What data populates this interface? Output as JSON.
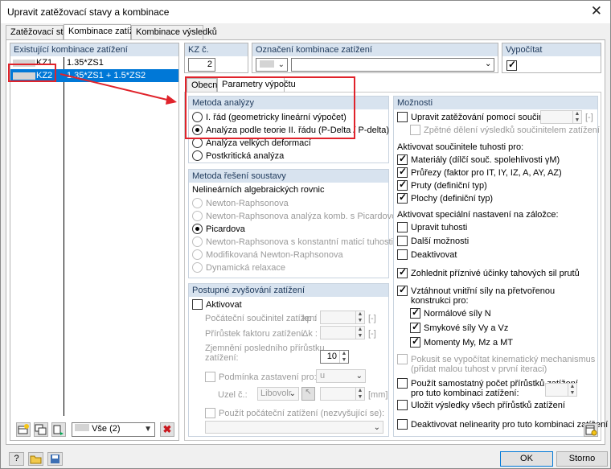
{
  "window": {
    "title": "Upravit zatěžovací stavy a kombinace",
    "close_glyph": "✕"
  },
  "tabs": [
    "Zatěžovací stavy",
    "Kombinace zatížení",
    "Kombinace výsledků"
  ],
  "left": {
    "header": "Existující kombinace zatížení",
    "rows": [
      {
        "id": "KZ1",
        "formula": "1.35*ZS1"
      },
      {
        "id": "KZ2",
        "formula": "1.35*ZS1 + 1.5*ZS2"
      }
    ],
    "filter_value": "Vše (2)"
  },
  "kz": {
    "label": "KZ č.",
    "value": "2"
  },
  "oznaceni": {
    "label": "Označení kombinace zatížení",
    "value": ""
  },
  "vypocitat": {
    "label": "Vypočítat",
    "checked": true
  },
  "subtabs": [
    "Obecné",
    "Parametry výpočtu"
  ],
  "metoda_analyzy": {
    "header": "Metoda analýzy",
    "options": [
      "I. řád (geometricky lineární výpočet)",
      "Analýza podle teorie II. řádu (P-Delta / P-delta)",
      "Analýza velkých deformací",
      "Postkritická analýza"
    ],
    "selected": 1
  },
  "metoda_reseni": {
    "header": "Metoda řešení soustavy",
    "sub": "Nelineárních algebraických rovnic",
    "options": [
      "Newton-Raphsonova",
      "Newton-Raphsonova analýza komb. s Picardovou",
      "Picardova",
      "Newton-Raphsonova s konstantní maticí tuhosti",
      "Modifikovaná Newton-Raphsonova",
      "Dynamická relaxace"
    ],
    "selected": 2
  },
  "postupne": {
    "header": "Postupné zvyšování zatížení",
    "aktivovat": "Aktivovat",
    "pocatecni": "Počáteční součinitel zatížení",
    "kp": "kp :",
    "prirustek": "Přírůstek faktoru zatížení",
    "dk": "Δk :",
    "unit": "[-]",
    "zjemneni_1": "Zjemnění posledního přírůstku",
    "zjemneni_2": "zatížení:",
    "zjemneni_value": "10",
    "podminka": "Podmínka zastavení pro:",
    "podminka_value": "u",
    "uzel": "Uzel č.:",
    "uzel_value": "Libovolr",
    "mm": "[mm]",
    "pouzit": "Použít počáteční zatížení (nezvyšující se):"
  },
  "moznosti": {
    "header": "Možnosti",
    "upravit": "Upravit zatěžování pomocí součinitele:",
    "unit": "[-]",
    "zpetne": "Zpětné dělení výsledků součinitelem zatížení",
    "aktivovat_tuhosti": "Aktivovat součinitele tuhosti pro:",
    "tuhosti": [
      "Materiály (dílčí souč. spolehlivosti γM)",
      "Průřezy (faktor pro IT, IY, IZ, A, AY, AZ)",
      "Pruty (definiční typ)",
      "Plochy (definiční typ)"
    ],
    "aktivovat_special": "Aktivovat speciální nastavení na záložce:",
    "special": [
      "Upravit tuhosti",
      "Další možnosti",
      "Deaktivovat"
    ],
    "zohlednit": "Zohlednit příznivé účinky tahových sil prutů",
    "vztahnout_1": "Vztáhnout vnitřní síly na přetvořenou",
    "vztahnout_2": "konstrukci pro:",
    "sily": [
      "Normálové síly N",
      "Smykové síly Vy a Vz",
      "Momenty My, Mz a MT"
    ],
    "pokusit_1": "Pokusit se vypočítat kinematický mechanismus",
    "pokusit_2": "(přidat malou tuhost v první iteraci)",
    "samostatny_1": "Použít samostatný počet přírůstků zatížení",
    "samostatny_2": "pro tuto kombinaci zatížení:",
    "ulozit": "Uložit výsledky všech přírůstků zatížení",
    "deaktivovat_nelinearity": "Deaktivovat nelinearity pro tuto kombinaci zatížení"
  },
  "footer": {
    "ok": "OK",
    "storno": "Storno"
  }
}
